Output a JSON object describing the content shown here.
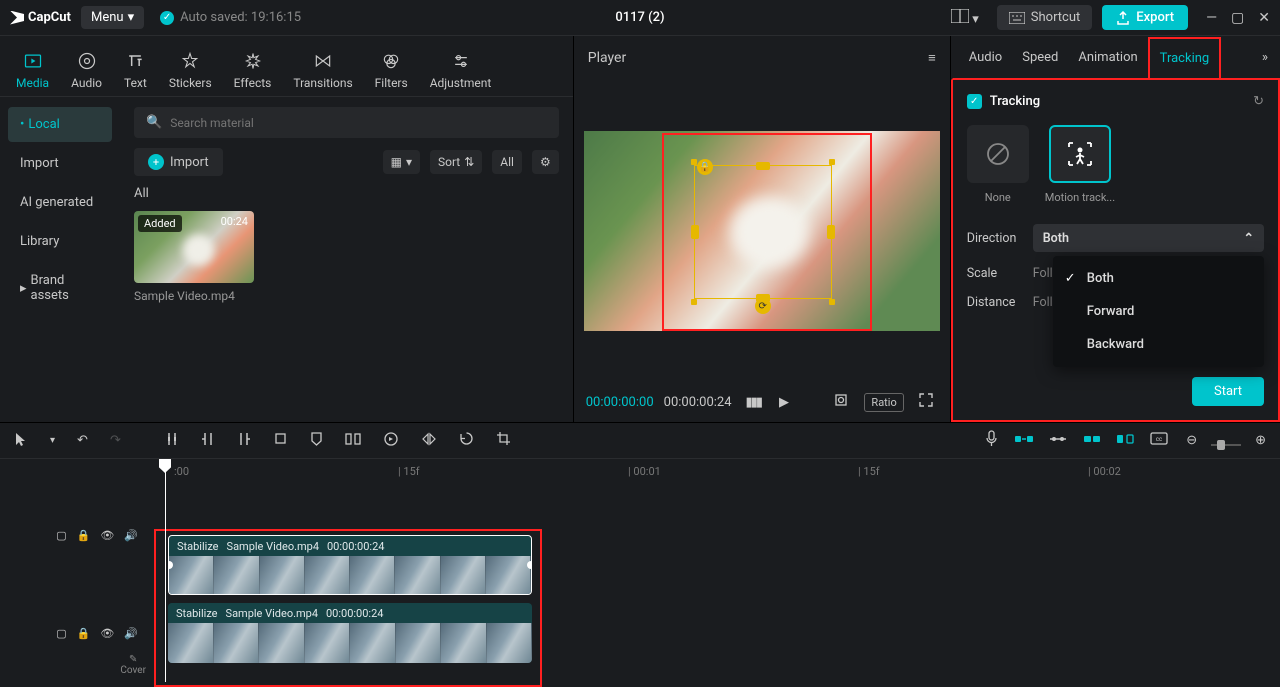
{
  "app": {
    "name": "CapCut",
    "menu": "Menu",
    "autosave": "Auto saved: 19:16:15",
    "title": "0117 (2)"
  },
  "topbar": {
    "shortcut": "Shortcut",
    "export": "Export"
  },
  "toolTabs": [
    {
      "label": "Media"
    },
    {
      "label": "Audio"
    },
    {
      "label": "Text"
    },
    {
      "label": "Stickers"
    },
    {
      "label": "Effects"
    },
    {
      "label": "Transitions"
    },
    {
      "label": "Filters"
    },
    {
      "label": "Adjustment"
    }
  ],
  "sidebar": [
    {
      "label": "Local"
    },
    {
      "label": "Import"
    },
    {
      "label": "AI generated"
    },
    {
      "label": "Library"
    },
    {
      "label": "Brand assets"
    }
  ],
  "search": {
    "placeholder": "Search material"
  },
  "importBtn": "Import",
  "sort": "Sort",
  "all": "All",
  "allHeader": "All",
  "media": [
    {
      "added": "Added",
      "duration": "00:24",
      "name": "Sample Video.mp4"
    }
  ],
  "player": {
    "title": "Player",
    "current": "00:00:00:00",
    "total": "00:00:00:24",
    "ratio": "Ratio"
  },
  "rightTabs": [
    {
      "label": "Audio"
    },
    {
      "label": "Speed"
    },
    {
      "label": "Animation"
    },
    {
      "label": "Tracking"
    }
  ],
  "tracking": {
    "title": "Tracking",
    "none": "None",
    "motion": "Motion track...",
    "direction": "Direction",
    "directionVal": "Both",
    "scale": "Scale",
    "scaleVal": "Follow tr...",
    "distance": "Distance",
    "distanceVal": "Follo...",
    "start": "Start",
    "options": [
      "Both",
      "Forward",
      "Backward"
    ]
  },
  "timelineRuler": [
    {
      "pos": 22,
      "label": ":00"
    },
    {
      "pos": 246,
      "label": "| 15f"
    },
    {
      "pos": 476,
      "label": "| 00:01"
    },
    {
      "pos": 706,
      "label": "| 15f"
    },
    {
      "pos": 936,
      "label": "| 00:02"
    }
  ],
  "clips": [
    {
      "stabilize": "Stabilize",
      "name": "Sample Video.mp4",
      "dur": "00:00:00:24"
    },
    {
      "stabilize": "Stabilize",
      "name": "Sample Video.mp4",
      "dur": "00:00:00:24"
    }
  ],
  "cover": "Cover"
}
